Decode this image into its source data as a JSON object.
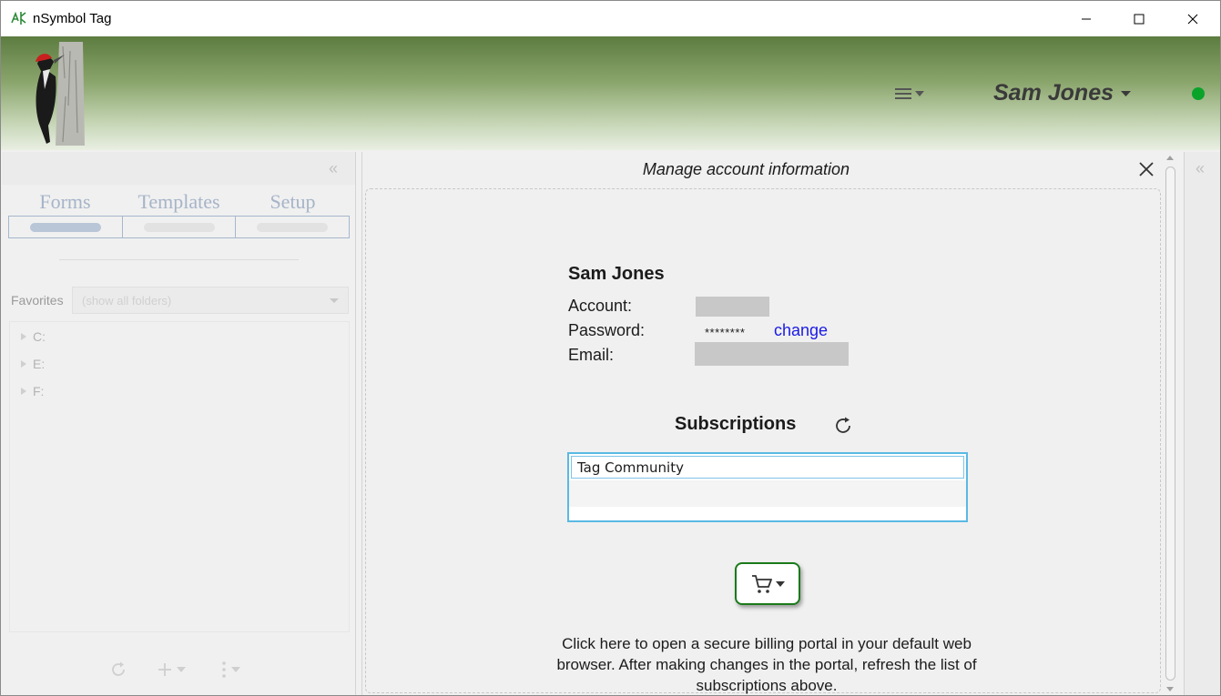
{
  "window": {
    "title": "nSymbol Tag",
    "controls": {
      "minimize": "minimize",
      "maximize": "maximize",
      "close": "close"
    }
  },
  "banner": {
    "user_name": "Sam Jones",
    "status_color": "#0aa32a"
  },
  "left_panel": {
    "tabs": [
      "Forms",
      "Templates",
      "Setup"
    ],
    "favorites_label": "Favorites",
    "favorites_placeholder": "(show all folders)",
    "tree_items": [
      "C:",
      "E:",
      "F:"
    ]
  },
  "center": {
    "title": "Manage account information",
    "account": {
      "name": "Sam Jones",
      "account_label": "Account:",
      "password_label": "Password:",
      "password_mask": "********",
      "change_link": "change",
      "email_label": "Email:"
    },
    "subscriptions": {
      "title": "Subscriptions",
      "items": [
        "Tag Community"
      ]
    },
    "billing_text": "Click here to open a secure billing portal in your default web browser. After making changes in the portal, refresh the list of subscriptions above."
  },
  "colors": {
    "banner_top": "#5c7c40",
    "cart_border": "#1a7a1a",
    "link": "#1a1ae6",
    "list_border": "#5ab9e3"
  }
}
